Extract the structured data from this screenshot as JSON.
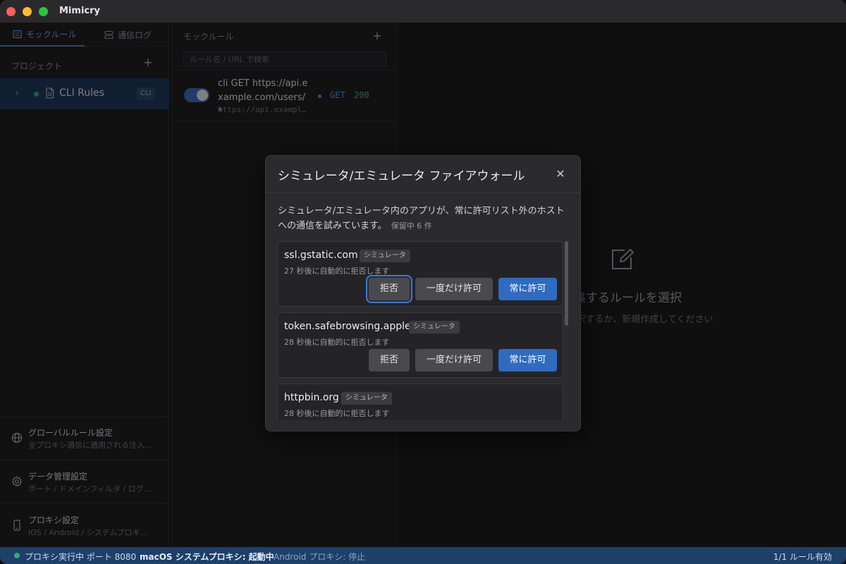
{
  "app": {
    "title": "Mimicry"
  },
  "sidebar": {
    "tabs": [
      {
        "label": "モックルール",
        "icon": "list-icon",
        "active": true
      },
      {
        "label": "通信ログ",
        "icon": "log-icon",
        "active": false
      }
    ],
    "projects_header": "プロジェクト",
    "projects": [
      {
        "name": "CLI Rules",
        "badge": "CLI",
        "status_color": "#3aa680"
      }
    ],
    "settings": [
      {
        "title": "グローバルルール設定",
        "subtitle": "全プロキシ通信に適用される注入...",
        "icon": "globe-icon"
      },
      {
        "title": "データ管理設定",
        "subtitle": "ポート / ドメインフィルタ / ログ...",
        "icon": "gear-icon"
      },
      {
        "title": "プロキシ設定",
        "subtitle": "iOS / Android / システムプロキ...",
        "icon": "phone-icon"
      }
    ]
  },
  "rules": {
    "header": "モックルール",
    "search_placeholder": "ルール名 / URL で検索",
    "items": [
      {
        "name": "cli GET https://api.example.com/users/*",
        "url": "https://api.example.com/users/*",
        "method": "GET",
        "status": "200",
        "enabled": true
      }
    ]
  },
  "main": {
    "empty_title": "編集するルールを選択",
    "empty_subtitle": "ルールを選択するか、新規作成してください"
  },
  "statusbar": {
    "proxy": "プロキシ実行中 ポート 8080",
    "macos": "macOS システムプロキシ: 起動中",
    "android": "Android プロキシ: 停止",
    "rules_active": "1/1 ルール有効"
  },
  "modal": {
    "title": "シミュレータ/エミュレータ ファイアウォール",
    "description": "シミュレータ/エミュレータ内のアプリが、常に許可リスト外のホストへの通信を試みています。",
    "pending": "保留中 6 件",
    "buttons": {
      "deny": "拒否",
      "allow_once": "一度だけ許可",
      "allow_always": "常に許可"
    },
    "requests": [
      {
        "host": "ssl.gstatic.com",
        "tag": "シミュレータ",
        "countdown": "27 秒後に自動的に拒否します"
      },
      {
        "host": "token.safebrowsing.apple",
        "tag": "シミュレータ",
        "countdown": "28 秒後に自動的に拒否します"
      },
      {
        "host": "httpbin.org",
        "tag": "シミュレータ",
        "countdown": "28 秒後に自動的に拒否します"
      }
    ]
  },
  "colors": {
    "accent": "#2f6bc0",
    "statusbar": "#1d3f6a",
    "running": "#3aa680",
    "method_get": "#5a9ae8",
    "status_ok": "#4caf7a"
  }
}
